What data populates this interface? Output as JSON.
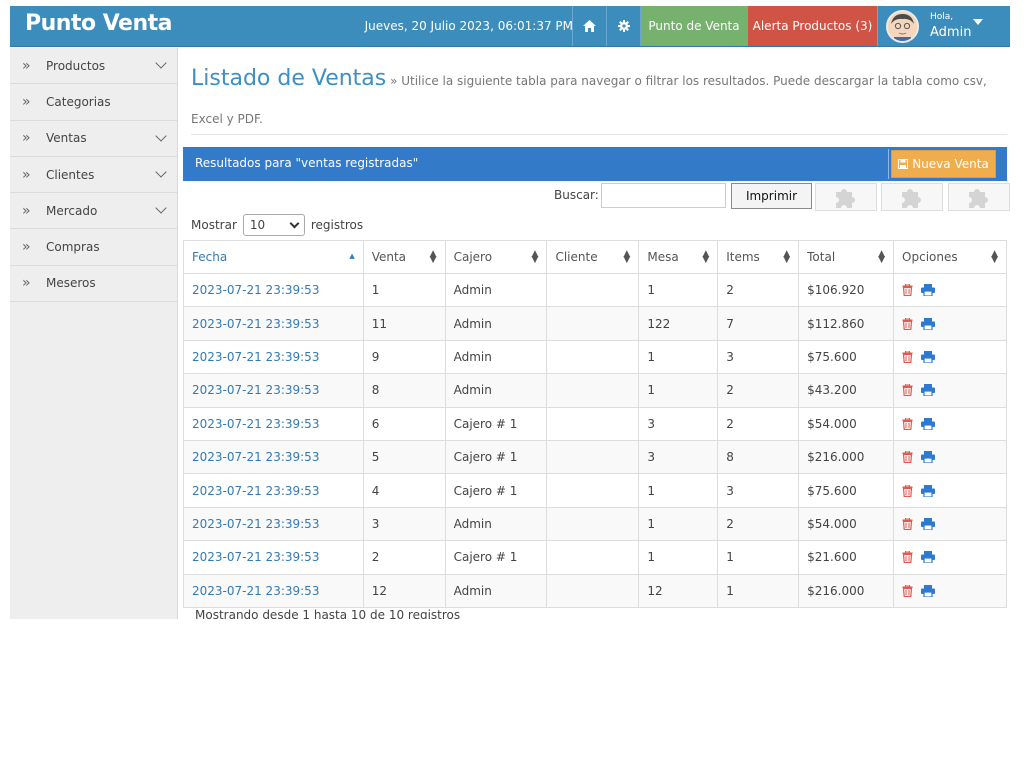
{
  "brand": "Punto Venta",
  "datetime": "Jueves, 20 Julio 2023, 06:01:37 PM",
  "nav": {
    "punto_de_venta": "Punto de Venta",
    "alerta": "Alerta Productos (3)",
    "hola": "Hola,",
    "user": "Admin"
  },
  "icons": {
    "home": "home-icon",
    "gear": "gear-icon",
    "caret": "caret-down-icon"
  },
  "colors": {
    "topbar": "#3c8dbc",
    "punto_btn": "#76b26d",
    "alerta_btn": "#d05446",
    "results_bar": "#337bc8",
    "nueva_btn": "#f0ad4e",
    "link": "#337ab7",
    "delete": "#e05a4f"
  },
  "sidebar": {
    "items": [
      {
        "label": "Productos",
        "expandable": true
      },
      {
        "label": "Categorias",
        "expandable": false
      },
      {
        "label": "Ventas",
        "expandable": true
      },
      {
        "label": "Clientes",
        "expandable": true
      },
      {
        "label": "Mercado",
        "expandable": true
      },
      {
        "label": "Compras",
        "expandable": false
      },
      {
        "label": "Meseros",
        "expandable": false
      }
    ]
  },
  "page": {
    "title": "Listado de Ventas",
    "subtitle": "» Utilice la siguiente tabla para navegar o filtrar los resultados. Puede descargar la tabla como csv, Excel y PDF."
  },
  "results": {
    "text": "Resultados para \"ventas registradas\"",
    "nueva": "Nueva Venta"
  },
  "search": {
    "label": "Buscar:",
    "value": ""
  },
  "print_label": "Imprimir",
  "length": {
    "prefix": "Mostrar",
    "value": "10",
    "suffix": "registros"
  },
  "table": {
    "headers": [
      "Fecha",
      "Venta",
      "Cajero",
      "Cliente",
      "Mesa",
      "Items",
      "Total",
      "Opciones"
    ],
    "rows": [
      [
        "2023-07-21 23:39:53",
        "1",
        "Admin",
        "",
        "1",
        "2",
        "$106.920"
      ],
      [
        "2023-07-21 23:39:53",
        "11",
        "Admin",
        "",
        "122",
        "7",
        "$112.860"
      ],
      [
        "2023-07-21 23:39:53",
        "9",
        "Admin",
        "",
        "1",
        "3",
        "$75.600"
      ],
      [
        "2023-07-21 23:39:53",
        "8",
        "Admin",
        "",
        "1",
        "2",
        "$43.200"
      ],
      [
        "2023-07-21 23:39:53",
        "6",
        "Cajero # 1",
        "",
        "3",
        "2",
        "$54.000"
      ],
      [
        "2023-07-21 23:39:53",
        "5",
        "Cajero # 1",
        "",
        "3",
        "8",
        "$216.000"
      ],
      [
        "2023-07-21 23:39:53",
        "4",
        "Cajero # 1",
        "",
        "1",
        "3",
        "$75.600"
      ],
      [
        "2023-07-21 23:39:53",
        "3",
        "Admin",
        "",
        "1",
        "2",
        "$54.000"
      ],
      [
        "2023-07-21 23:39:53",
        "2",
        "Cajero # 1",
        "",
        "1",
        "1",
        "$21.600"
      ],
      [
        "2023-07-21 23:39:53",
        "12",
        "Admin",
        "",
        "12",
        "1",
        "$216.000"
      ]
    ]
  },
  "footer": "Mostrando desde 1 hasta 10 de 10 registros"
}
